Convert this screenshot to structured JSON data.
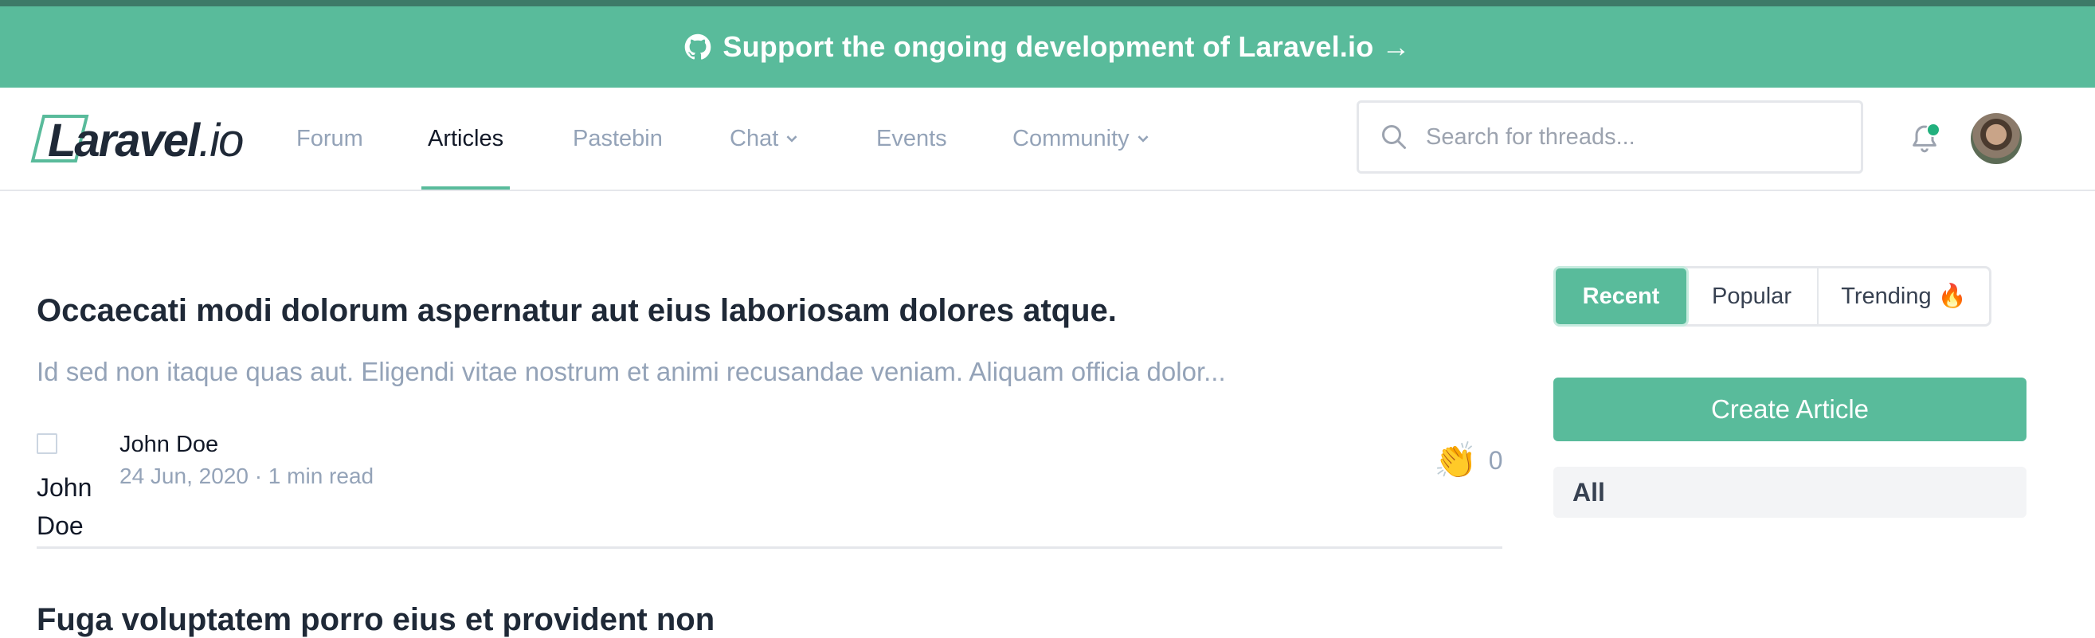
{
  "banner": {
    "text": "Support the ongoing development of Laravel.io",
    "arrow": "→",
    "icon": "github-icon"
  },
  "logo": {
    "main": "Laravel",
    "suffix": ".io"
  },
  "nav": {
    "items": [
      {
        "label": "Forum"
      },
      {
        "label": "Articles",
        "active": true
      },
      {
        "label": "Pastebin"
      },
      {
        "label": "Chat",
        "dropdown": true
      },
      {
        "label": "Events"
      },
      {
        "label": "Community",
        "dropdown": true
      }
    ],
    "search_placeholder": "Search for threads...",
    "icons": {
      "search": "search-icon",
      "notifications": "bell-icon",
      "avatar": "user-avatar"
    }
  },
  "articles": [
    {
      "title": "Occaecati modi dolorum aspernatur aut eius laboriosam dolores atque.",
      "excerpt": "Id sed non itaque quas aut. Eligendi vitae nostrum et animi recusandae veniam. Aliquam officia dolor...",
      "author_alt": "John Doe",
      "author": "John Doe",
      "meta": "24 Jun, 2020 · 1 min read",
      "claps_emoji": "👏",
      "claps": "0"
    },
    {
      "title": "Fuga voluptatem porro eius et provident non"
    }
  ],
  "sidebar": {
    "tabs": [
      "Recent",
      "Popular",
      "Trending 🔥"
    ],
    "active_tab": "Recent",
    "create_button": "Create Article",
    "filter_label": "All"
  },
  "colors": {
    "brand": "#59bb9b",
    "topline": "#3d7a68",
    "muted": "#94a3b8"
  }
}
